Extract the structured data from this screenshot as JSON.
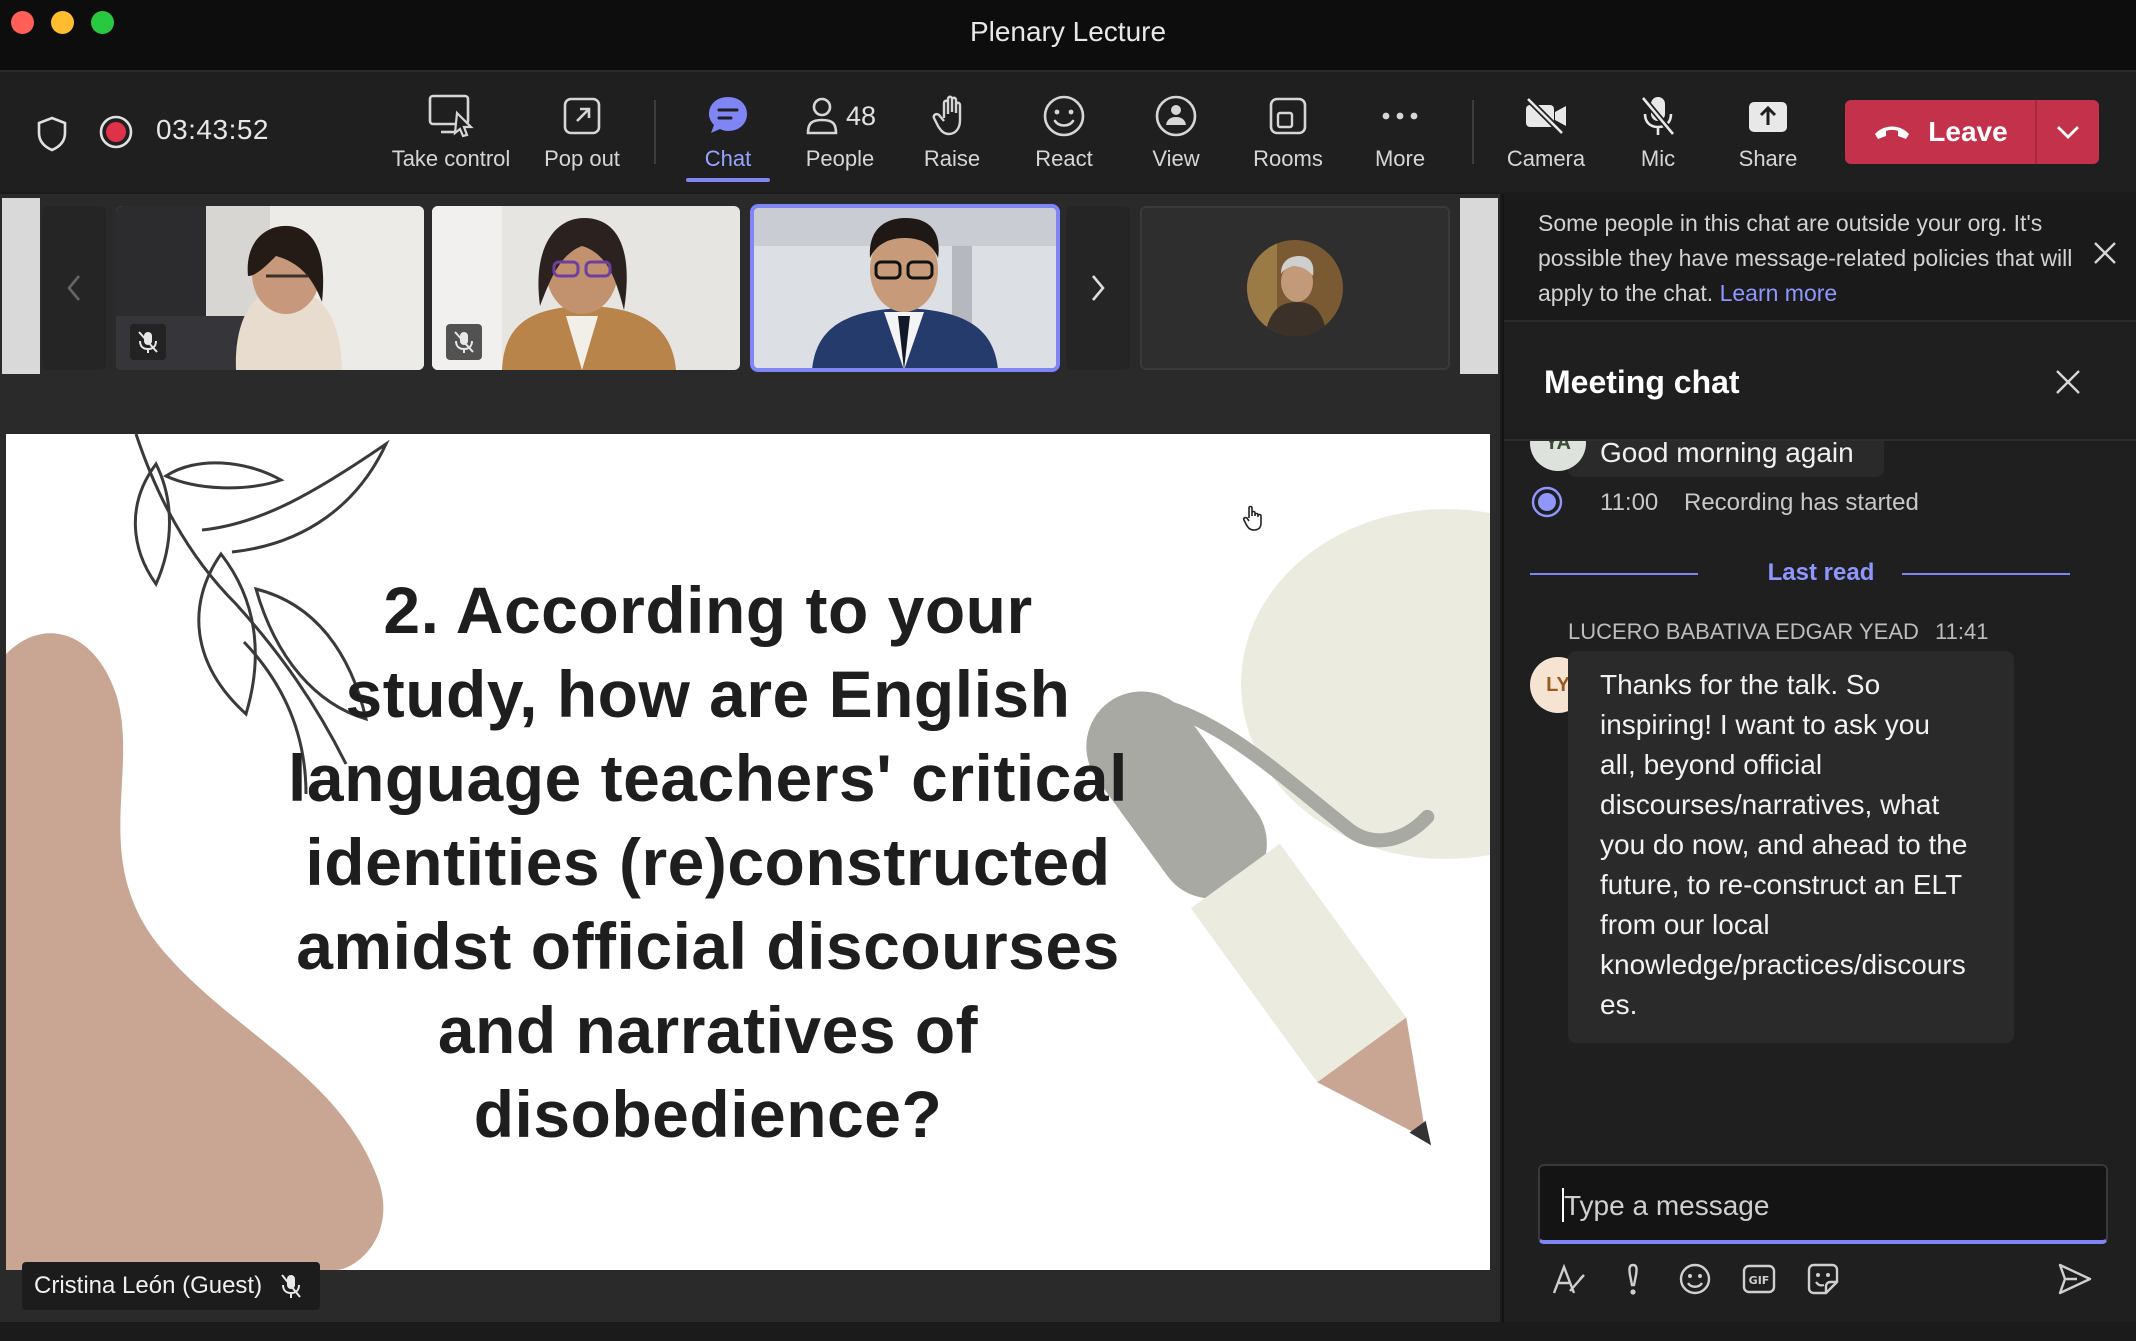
{
  "window": {
    "title": "Plenary Lecture"
  },
  "toolbar": {
    "timer": "03:43:52",
    "items": [
      {
        "label": "Take control"
      },
      {
        "label": "Pop out"
      },
      {
        "label": "Chat"
      },
      {
        "label": "People",
        "count": "48"
      },
      {
        "label": "Raise"
      },
      {
        "label": "React"
      },
      {
        "label": "View"
      },
      {
        "label": "Rooms"
      },
      {
        "label": "More"
      },
      {
        "label": "Camera"
      },
      {
        "label": "Mic"
      },
      {
        "label": "Share"
      }
    ],
    "leave_label": "Leave"
  },
  "slide": {
    "lines": [
      "2. According to your",
      "study, how are English",
      "language teachers' critical",
      "identities (re)constructed",
      "amidst official discourses",
      "and narratives of",
      "disobedience?"
    ]
  },
  "presenter": {
    "name": "Cristina León (Guest)"
  },
  "chat": {
    "banner_text": "Some people in this chat are outside your org. It's possible they have message-related policies that will apply to the chat.",
    "banner_link": "Learn more",
    "title": "Meeting chat",
    "prev_message": {
      "avatar": "YA",
      "text": "Good morning again"
    },
    "system": {
      "time": "11:00",
      "text": "Recording has started"
    },
    "last_read": "Last read",
    "message": {
      "author": "LUCERO BABATIVA EDGAR YEAD",
      "time": "11:41",
      "avatar": "LY",
      "lines": [
        "Thanks for the talk. So",
        "inspiring!   I want to ask you",
        "all, beyond official",
        "discourses/narratives, what",
        "you do now, and ahead to the",
        "future, to re-construct an ELT",
        "from our local",
        "knowledge/practices/discours",
        "es."
      ]
    },
    "compose_placeholder": "Type a message"
  }
}
